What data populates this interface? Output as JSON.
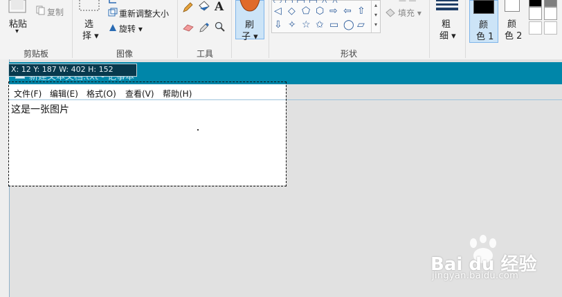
{
  "ribbon": {
    "clipboard": {
      "paste_label": "粘贴",
      "paste_arrow": "▾",
      "copy_label": "复制",
      "group_label": "剪贴板"
    },
    "image": {
      "select_label_1": "选",
      "select_label_2": "择 ▾",
      "resize_label": "重新调整大小",
      "rotate_label": "旋转 ▾",
      "group_label": "图像"
    },
    "tools": {
      "text_tool_glyph": "A",
      "group_label": "工具"
    },
    "brushes": {
      "label_1": "刷",
      "label_2": "子 ▾"
    },
    "shapes": {
      "fill_label": "填充 ▾",
      "group_label": "形状",
      "glyphs_row1": [
        "◁",
        "◇",
        "⬠",
        "⬡",
        "⇨",
        "⇦",
        "⇧"
      ],
      "glyphs_row2": [
        "⇩",
        "✧",
        "☆",
        "✩",
        "▭",
        "◯",
        "▱"
      ]
    },
    "size": {
      "label_1": "粗",
      "label_2": "细 ▾"
    },
    "color1": {
      "label_1": "颜",
      "label_2": "色 1",
      "swatch": "#000000"
    },
    "color2": {
      "label_1": "颜",
      "label_2": "色 2",
      "swatch": "#ffffff"
    },
    "palette": [
      "#000000",
      "#7f7f7f",
      "#ffffff",
      "#ffffff",
      "#ffffff",
      "#ffffff"
    ]
  },
  "canvas": {
    "status": "X: 12 Y: 187 W: 402 H: 152",
    "window_title": "新建文本文档.txt - 记事本",
    "notepad_menu": [
      "文件(F)",
      "编辑(E)",
      "格式(O)",
      "查看(V)",
      "帮助(H)"
    ],
    "notepad_text": "这是一张图片"
  },
  "watermark": {
    "brand": "Bai du 经验",
    "url": "jingyan.baidu.com"
  },
  "colors": {
    "teal": "#0086a9",
    "ribbon_bg": "#f3f3f3",
    "canvas_bg": "#e1e1e1"
  }
}
